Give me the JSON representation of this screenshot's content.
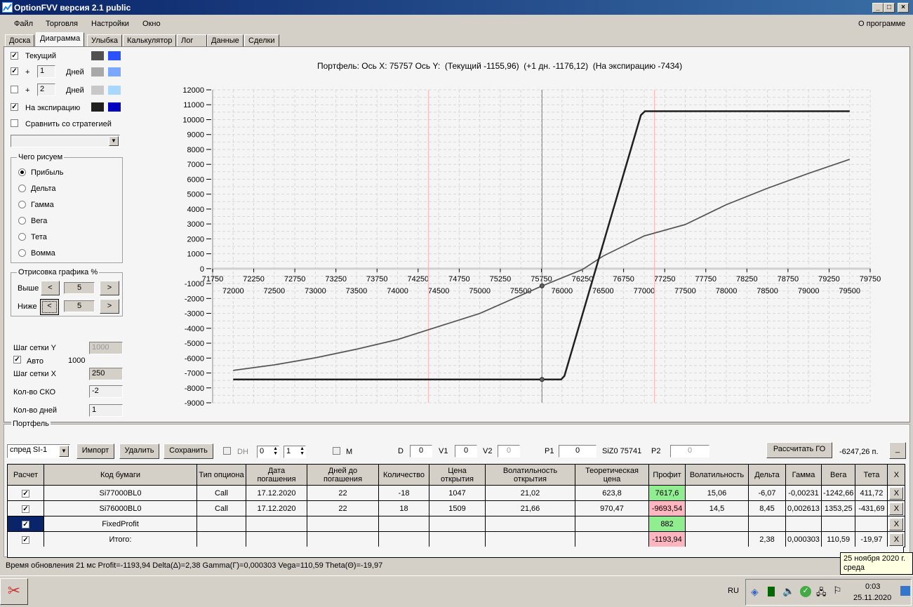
{
  "window": {
    "title": "OptionFVV версия 2.1 public"
  },
  "menu": [
    "Файл",
    "Торговля",
    "Настройки",
    "Окно"
  ],
  "about": "О программе",
  "tabs": [
    "Доска",
    "Диаграмма",
    "Улыбка",
    "Калькулятор",
    "Лог",
    "Данные",
    "Сделки"
  ],
  "active_tab": "Диаграмма",
  "left": {
    "current": {
      "label": "Текущий",
      "checked": true,
      "colors": [
        "#505050",
        "#2a52ff"
      ]
    },
    "plus1": {
      "prefix": "+",
      "days": "1",
      "label": "Дней",
      "checked": true,
      "colors": [
        "#a8a8a8",
        "#7aa8ff"
      ]
    },
    "plus2": {
      "prefix": "+",
      "days": "2",
      "label": "Дней",
      "checked": false,
      "colors": [
        "#c8c8c8",
        "#a8d8ff"
      ]
    },
    "expiry": {
      "label": "На экспирацию",
      "checked": true,
      "colors": [
        "#202020",
        "#0000c0"
      ]
    },
    "compare": {
      "label": "Сравнить со стратегией",
      "checked": false
    },
    "draw_group": {
      "title": "Чего рисуем",
      "options": [
        "Прибыль",
        "Дельта",
        "Гамма",
        "Вега",
        "Тета",
        "Вомма"
      ],
      "selected": "Прибыль"
    },
    "render_group": {
      "title": "Отрисовка графика %",
      "above_label": "Выше",
      "above": "5",
      "below_label": "Ниже",
      "below": "5",
      "prev": "<",
      "next": ">"
    },
    "grid_y_label": "Шаг сетки Y",
    "grid_y": "1000",
    "auto_label": "Авто",
    "auto_checked": true,
    "auto_value": "1000",
    "grid_x_label": "Шаг сетки X",
    "grid_x": "250",
    "sko_label": "Кол-во СКО",
    "sko": "-2",
    "days_label": "Кол-во дней",
    "days": "1"
  },
  "chart_header": "Портфель: Ось X: 75757 Ось Y:  (Текущий -1155,96)  (+1 дн. -1176,12)  (На экспирацию -7434)",
  "chart_data": {
    "type": "line",
    "xlim": [
      71750,
      79750
    ],
    "ylim": [
      -9000,
      12000
    ],
    "x_ticks_upper": [
      71750,
      72250,
      72750,
      73250,
      73750,
      74250,
      74750,
      75250,
      75750,
      76250,
      76750,
      77250,
      77750,
      78250,
      78750,
      79250,
      79750
    ],
    "x_ticks_lower": [
      72000,
      72500,
      73000,
      73500,
      74000,
      74500,
      75000,
      75500,
      76000,
      76500,
      77000,
      77500,
      78000,
      78500,
      79000,
      79500
    ],
    "y_ticks": [
      12000,
      11000,
      10000,
      9000,
      8000,
      7000,
      6000,
      5000,
      4000,
      3000,
      2000,
      1000,
      0,
      -1000,
      -2000,
      -3000,
      -4000,
      -5000,
      -6000,
      -7000,
      -8000,
      -9000
    ],
    "grid": true,
    "cursor_x": 75757,
    "sigma_lines": [
      74374,
      77126
    ],
    "series": [
      {
        "key": "expiry",
        "color": "#202020",
        "points": [
          [
            72000,
            -7434
          ],
          [
            75990,
            -7434
          ],
          [
            76030,
            -7200
          ],
          [
            76960,
            10300
          ],
          [
            77010,
            10566
          ],
          [
            79500,
            10566
          ]
        ]
      },
      {
        "key": "current",
        "color": "#505050",
        "points": [
          [
            72000,
            -6824
          ],
          [
            72500,
            -6450
          ],
          [
            73000,
            -5976
          ],
          [
            73500,
            -5400
          ],
          [
            74000,
            -4750
          ],
          [
            74374,
            -4094
          ],
          [
            75000,
            -3000
          ],
          [
            75757,
            -1156
          ],
          [
            76250,
            -50
          ],
          [
            76500,
            847
          ],
          [
            77000,
            2200
          ],
          [
            77500,
            2965
          ],
          [
            78000,
            4300
          ],
          [
            78500,
            5400
          ],
          [
            79000,
            6400
          ],
          [
            79500,
            7341
          ]
        ]
      },
      {
        "key": "plus1",
        "color": "#a8a8a8",
        "points": [
          [
            72000,
            -6840
          ],
          [
            72500,
            -6470
          ],
          [
            73000,
            -6000
          ],
          [
            73500,
            -5425
          ],
          [
            74000,
            -4775
          ],
          [
            74374,
            -4115
          ],
          [
            75000,
            -3020
          ],
          [
            75757,
            -1176
          ],
          [
            76250,
            -70
          ],
          [
            76500,
            830
          ],
          [
            77000,
            2180
          ],
          [
            77500,
            2945
          ],
          [
            78000,
            4280
          ],
          [
            78500,
            5380
          ],
          [
            79000,
            6380
          ],
          [
            79500,
            7320
          ]
        ]
      }
    ],
    "markers": [
      [
        75757,
        -1156
      ],
      [
        75757,
        -7434
      ]
    ]
  },
  "portfolio": {
    "title": "Портфель",
    "strategy": "спред SI-1",
    "import": "Импорт",
    "delete": "Удалить",
    "save": "Сохранить",
    "dh_label": "DH",
    "dh_checked": false,
    "spin1": "0",
    "spin2": "1",
    "m_label": "M",
    "m_checked": false,
    "d_label": "D",
    "d": "0",
    "v1_label": "V1",
    "v1": "0",
    "v2_label": "V2",
    "v2": "0",
    "p1_label": "P1",
    "p1": "0",
    "underlying": "SiZ0 75741",
    "p2_label": "P2",
    "p2": "0",
    "calc_go": "Рассчитать ГО",
    "go_value": "-6247,26 п.",
    "min": "_",
    "columns": [
      "Расчет",
      "Код бумаги",
      "Тип опциона",
      "Дата погашения",
      "Дней до погашения",
      "Количество",
      "Цена открытия",
      "Волатильность открытия",
      "Теоретическая цена",
      "Профит",
      "Волатильность",
      "Дельта",
      "Гамма",
      "Вега",
      "Тета",
      "X"
    ],
    "rows": [
      {
        "calc": true,
        "code": "Si77000BL0",
        "type": "Call",
        "date": "17.12.2020",
        "days": "22",
        "qty": "-18",
        "price": "1047",
        "vol_open": "21,02",
        "theo": "623,8",
        "profit": "7617,6",
        "profit_color": "green",
        "vol": "15,06",
        "delta": "-6,07",
        "gamma": "-0,00231",
        "vega": "-1242,66",
        "theta": "411,72",
        "x": "X"
      },
      {
        "calc": true,
        "code": "Si76000BL0",
        "type": "Call",
        "date": "17.12.2020",
        "days": "22",
        "qty": "18",
        "price": "1509",
        "vol_open": "21,66",
        "theo": "970,47",
        "profit": "-9693,54",
        "profit_color": "red",
        "vol": "14,5",
        "delta": "8,45",
        "gamma": "0,002613",
        "vega": "1353,25",
        "theta": "-431,69",
        "x": "X"
      },
      {
        "calc": true,
        "code": "FixedProfit",
        "type": "",
        "date": "",
        "days": "",
        "qty": "",
        "price": "",
        "vol_open": "",
        "theo": "",
        "profit": "882",
        "profit_color": "green",
        "vol": "",
        "delta": "",
        "gamma": "",
        "vega": "",
        "theta": "",
        "x": "X",
        "selected": true
      },
      {
        "calc": true,
        "code": "Итого:",
        "type": "",
        "date": "",
        "days": "",
        "qty": "",
        "price": "",
        "vol_open": "",
        "theo": "",
        "profit": "-1193,94",
        "profit_color": "red",
        "vol": "",
        "delta": "2,38",
        "gamma": "0,000303",
        "vega": "110,59",
        "theta": "-19,97",
        "x": "X"
      }
    ]
  },
  "status": "Время обновления 21 мс  Profit=-1193,94 Delta(Δ)=2,38 Gamma(Γ)=0,000303 Vega=110,59 Theta(Θ)=-19,97",
  "tooltip": {
    "line1": "25 ноября 2020 г.",
    "line2": "среда"
  },
  "taskbar": {
    "lang": "RU",
    "time": "0:03",
    "date": "25.11.2020"
  }
}
